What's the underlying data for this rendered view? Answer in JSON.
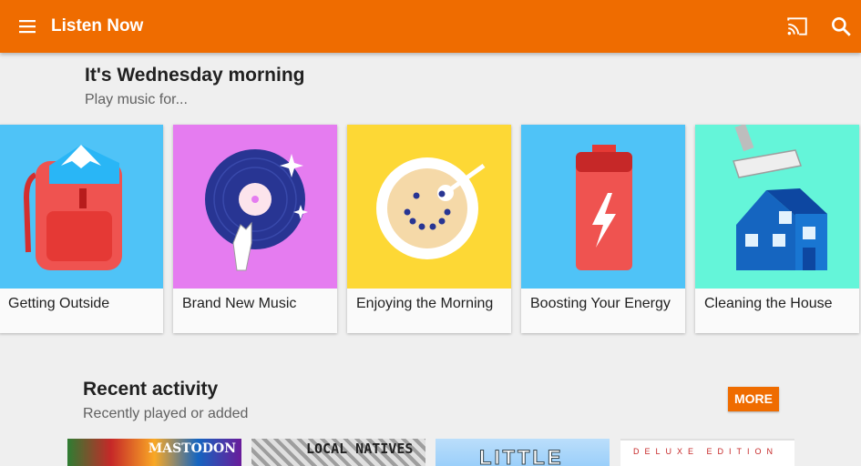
{
  "appbar": {
    "title": "Listen Now",
    "background": "#ef6c00",
    "icons": [
      "menu-icon",
      "cast-icon",
      "search-icon"
    ]
  },
  "greeting": {
    "title": "It's Wednesday morning",
    "subtitle": "Play music for..."
  },
  "activities": [
    {
      "label": "Getting Outside",
      "color": "#4fc3f7",
      "icon": "backpack-icon"
    },
    {
      "label": "Brand New Music",
      "color": "#e57cf0",
      "icon": "vinyl-record-icon"
    },
    {
      "label": "Enjoying the Morning",
      "color": "#fdd835",
      "icon": "cereal-bowl-icon"
    },
    {
      "label": "Boosting Your Energy",
      "color": "#4fc3f7",
      "icon": "battery-icon"
    },
    {
      "label": "Cleaning the House",
      "color": "#64f5d9",
      "icon": "house-vacuum-icon"
    }
  ],
  "recent": {
    "title": "Recent activity",
    "subtitle": "Recently played or added",
    "more_label": "MORE",
    "albums": [
      {
        "cover_text": "MASTODON"
      },
      {
        "cover_text": "LOCAL NATIVES"
      },
      {
        "cover_text": "LITTLE"
      },
      {
        "cover_text": "DELUXE EDITION"
      }
    ]
  }
}
